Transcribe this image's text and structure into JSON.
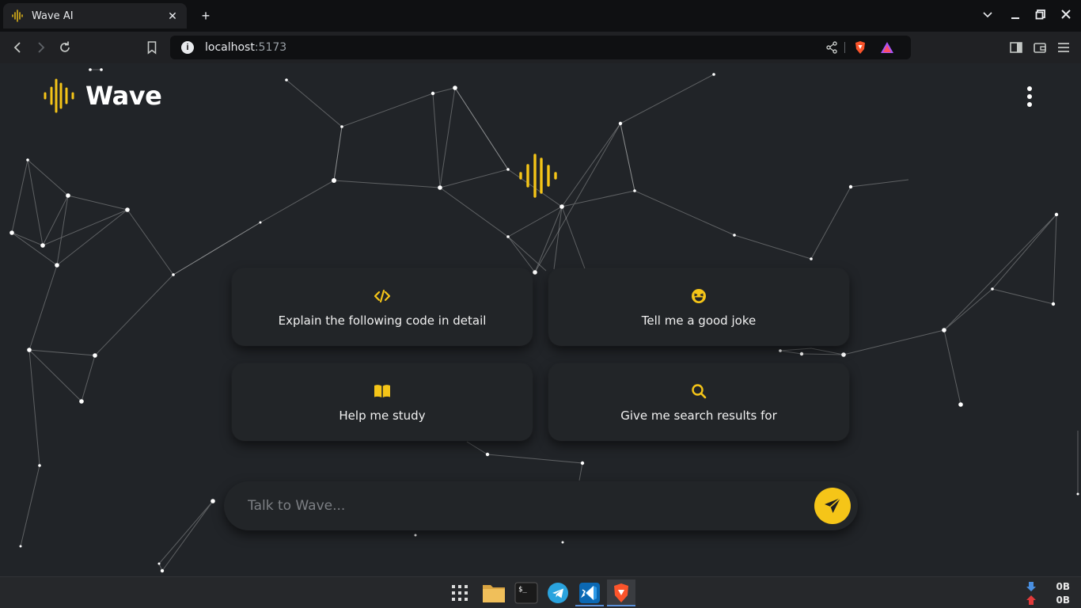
{
  "browser": {
    "tab_title": "Wave AI",
    "tab_close": "✕",
    "new_tab": "+",
    "url_host": "localhost",
    "url_port": ":5173",
    "icons": [
      "back-icon",
      "forward-icon",
      "reload-icon",
      "bookmark-icon",
      "info-icon",
      "share-icon",
      "brave-shields-icon",
      "brave-rewards-icon",
      "sidebar-icon",
      "wallet-icon",
      "menu-icon"
    ]
  },
  "app": {
    "name": "Wave",
    "accent_color": "#f5c518",
    "background_color": "#212428"
  },
  "suggestions": [
    {
      "icon": "code-icon",
      "label": "Explain the following code in detail"
    },
    {
      "icon": "laughing-emoji-icon",
      "label": "Tell me a good joke"
    },
    {
      "icon": "book-icon",
      "label": "Help me study"
    },
    {
      "icon": "search-icon",
      "label": "Give me search results for"
    }
  ],
  "chat": {
    "placeholder": "Talk to Wave...",
    "send_icon": "paper-plane-icon"
  },
  "taskbar": {
    "apps": [
      "app-grid-icon",
      "files-icon",
      "terminal-icon",
      "telegram-icon",
      "vscode-icon",
      "brave-icon"
    ],
    "net_down": "0B",
    "net_up": "0B"
  }
}
